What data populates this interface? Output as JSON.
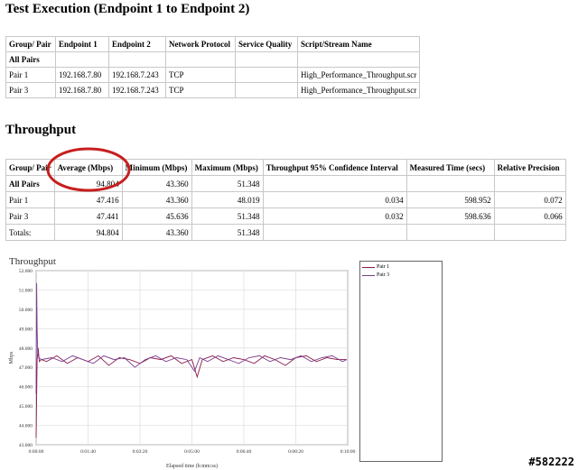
{
  "test_execution": {
    "heading": "Test Execution (Endpoint 1 to Endpoint 2)",
    "headers": [
      "Group/ Pair",
      "Endpoint 1",
      "Endpoint 2",
      "Network Protocol",
      "Service Quality",
      "Script/Stream Name"
    ],
    "rows": [
      [
        "All Pairs",
        "",
        "",
        "",
        "",
        ""
      ],
      [
        "Pair 1",
        "192.168.7.80",
        "192.168.7.243",
        "TCP",
        "",
        "High_Performance_Throughput.scr"
      ],
      [
        "Pair 3",
        "192.168.7.80",
        "192.168.7.243",
        "TCP",
        "",
        "High_Performance_Throughput.scr"
      ]
    ]
  },
  "throughput": {
    "heading": "Throughput",
    "headers": [
      "Group/ Pair",
      "Average (Mbps)",
      "Minimum (Mbps)",
      "Maximum (Mbps)",
      "Throughput 95% Confidence Interval",
      "Measured Time (secs)",
      "Relative Precision"
    ],
    "rows": [
      [
        "All Pairs",
        "94.804",
        "43.360",
        "51.348",
        "",
        "",
        ""
      ],
      [
        "Pair 1",
        "47.416",
        "43.360",
        "48.019",
        "0.034",
        "598.952",
        "0.072"
      ],
      [
        "Pair 3",
        "47.441",
        "45.636",
        "51.348",
        "0.032",
        "598.636",
        "0.066"
      ],
      [
        "Totals:",
        "94.804",
        "43.360",
        "51.348",
        "",
        "",
        ""
      ]
    ]
  },
  "chart_title": "Throughput",
  "chart_data": {
    "type": "line",
    "title": "Throughput",
    "xlabel": "Elapsed time (h:mm:ss)",
    "ylabel": "Mbps",
    "xlim": [
      0,
      600
    ],
    "ylim": [
      43,
      52
    ],
    "x_ticks": [
      0,
      100,
      200,
      300,
      400,
      500,
      600
    ],
    "x_tick_labels": [
      "0:00:00",
      "0:01:40",
      "0:03:20",
      "0:05:00",
      "0:06:40",
      "0:08:20",
      "0:10:00"
    ],
    "y_ticks": [
      43,
      44,
      45,
      46,
      47,
      48,
      49,
      50,
      51,
      52
    ],
    "y_tick_labels": [
      "43.000",
      "44.000",
      "45.000",
      "46.000",
      "47.000",
      "48.000",
      "49.000",
      "50.000",
      "51.000",
      "52.000"
    ],
    "grid": true,
    "legend": "right",
    "series": [
      {
        "name": "Pair 1",
        "color": "#8b1a4a",
        "x": [
          0,
          2,
          4,
          6,
          10,
          20,
          40,
          60,
          80,
          100,
          120,
          140,
          160,
          180,
          200,
          220,
          240,
          260,
          280,
          300,
          310,
          320,
          340,
          360,
          380,
          400,
          420,
          440,
          460,
          480,
          500,
          520,
          540,
          560,
          580,
          598
        ],
        "y": [
          43.36,
          47.4,
          48.0,
          47.3,
          47.4,
          47.3,
          47.6,
          47.2,
          47.5,
          47.3,
          47.6,
          47.1,
          47.5,
          47.4,
          47.2,
          47.5,
          47.4,
          47.6,
          47.2,
          47.4,
          46.5,
          47.4,
          47.6,
          47.3,
          47.5,
          47.4,
          47.2,
          47.6,
          47.4,
          47.1,
          47.5,
          47.6,
          47.3,
          47.5,
          47.4,
          47.4
        ]
      },
      {
        "name": "Pair 3",
        "color": "#7a3c8c",
        "x": [
          0,
          1,
          2,
          3,
          5,
          10,
          30,
          50,
          70,
          90,
          110,
          130,
          150,
          170,
          190,
          210,
          230,
          250,
          270,
          290,
          305,
          315,
          330,
          350,
          370,
          390,
          410,
          430,
          450,
          470,
          490,
          510,
          530,
          550,
          570,
          590,
          598
        ],
        "y": [
          45.64,
          51.35,
          49.0,
          47.8,
          47.5,
          47.4,
          47.5,
          47.3,
          47.6,
          47.4,
          47.2,
          47.6,
          47.4,
          47.5,
          47.0,
          47.4,
          47.6,
          47.3,
          47.5,
          47.4,
          46.8,
          47.5,
          47.3,
          47.6,
          47.4,
          47.2,
          47.5,
          47.6,
          47.3,
          47.5,
          47.4,
          47.6,
          47.3,
          47.5,
          47.6,
          47.3,
          47.4
        ]
      }
    ]
  },
  "annotation_color": "#c81e1e",
  "watermark": "#582222"
}
